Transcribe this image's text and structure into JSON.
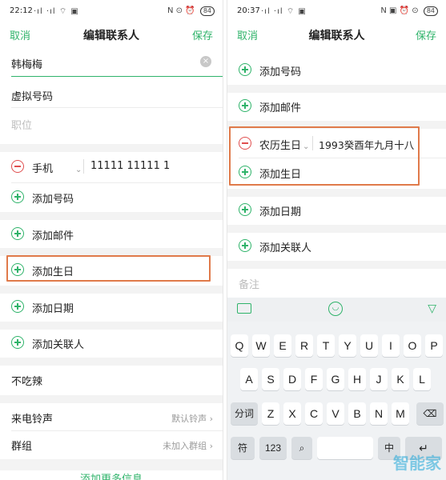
{
  "left": {
    "status": {
      "time": "22:12",
      "icons": "·ıl ·ıl ⌔ ▣",
      "right_icons": "N ⊙ ⏰",
      "battery": "84"
    },
    "header": {
      "cancel": "取消",
      "title": "编辑联系人",
      "save": "保存"
    },
    "fields": {
      "name_value": "韩梅梅",
      "virtual_number": "虚拟号码",
      "job_placeholder": "职位"
    },
    "phone": {
      "type": "手机",
      "number": "11111 11111 1"
    },
    "actions": [
      "添加号码",
      "添加邮件",
      "添加生日",
      "添加日期",
      "添加关联人"
    ],
    "note": "不吃辣",
    "ringtone": {
      "label": "来电铃声",
      "value": "默认铃声 ›"
    },
    "group": {
      "label": "群组",
      "value": "未加入群组 ›"
    },
    "bottom_link": "添加更多信息"
  },
  "right": {
    "status": {
      "time": "20:37",
      "icons": "·ıl ·ıl ⌔ ▣",
      "right_icons": "N ▣ ⏰ ⊙",
      "battery": "84"
    },
    "header": {
      "cancel": "取消",
      "title": "编辑联系人",
      "save": "保存"
    },
    "actions_top": [
      "添加号码",
      "添加邮件"
    ],
    "birthday": {
      "type": "农历生日",
      "value": "1993癸酉年九月十八"
    },
    "add_birthday": "添加生日",
    "actions_bottom": [
      "添加日期",
      "添加关联人"
    ],
    "remark_placeholder": "备注",
    "keyboard": {
      "row1": [
        "Q",
        "W",
        "E",
        "R",
        "T",
        "Y",
        "U",
        "I",
        "O",
        "P"
      ],
      "row2": [
        "A",
        "S",
        "D",
        "F",
        "G",
        "H",
        "J",
        "K",
        "L"
      ],
      "row3": [
        "分词",
        "Z",
        "X",
        "C",
        "V",
        "B",
        "N",
        "M",
        "⌫"
      ],
      "row4": [
        "符",
        "123",
        "⌕",
        "",
        "中",
        "↵"
      ]
    },
    "watermark": "智能家"
  },
  "colors": {
    "accent": "#2fb36a",
    "highlight": "#e07a4a",
    "minus": "#e04f4f"
  }
}
